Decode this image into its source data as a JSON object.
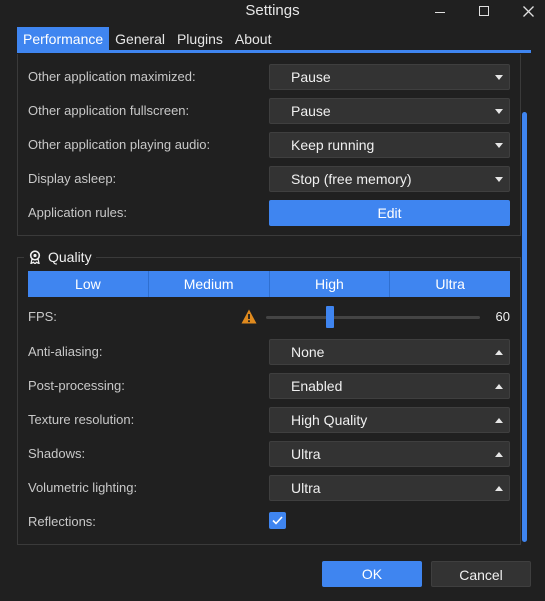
{
  "window": {
    "title": "Settings"
  },
  "tabs": [
    {
      "label": "Performance",
      "active": true
    },
    {
      "label": "General",
      "active": false
    },
    {
      "label": "Plugins",
      "active": false
    },
    {
      "label": "About",
      "active": false
    }
  ],
  "performance": {
    "rows": [
      {
        "label": "Other application maximized:",
        "value": "Pause"
      },
      {
        "label": "Other application fullscreen:",
        "value": "Pause"
      },
      {
        "label": "Other application playing audio:",
        "value": "Keep running"
      },
      {
        "label": "Display asleep:",
        "value": "Stop (free memory)"
      }
    ],
    "app_rules": {
      "label": "Application rules:",
      "button": "Edit"
    }
  },
  "quality": {
    "title": "Quality",
    "presets": [
      "Low",
      "Medium",
      "High",
      "Ultra"
    ],
    "fps": {
      "label": "FPS:",
      "value": "60",
      "slider_fraction": 0.3
    },
    "settings": [
      {
        "label": "Anti-aliasing:",
        "value": "None"
      },
      {
        "label": "Post-processing:",
        "value": "Enabled"
      },
      {
        "label": "Texture resolution:",
        "value": "High Quality"
      },
      {
        "label": "Shadows:",
        "value": "Ultra"
      },
      {
        "label": "Volumetric lighting:",
        "value": "Ultra"
      }
    ],
    "reflections": {
      "label": "Reflections:",
      "checked": true
    }
  },
  "footer": {
    "ok": "OK",
    "cancel": "Cancel"
  },
  "colors": {
    "accent": "#3f85f0",
    "background": "#202020",
    "control": "#333333",
    "warning": "#e08a1e"
  },
  "icons": {
    "minimize": "minimize-icon",
    "maximize": "maximize-icon",
    "close": "close-icon",
    "quality": "award-icon",
    "warning": "warning-icon",
    "check": "check-icon"
  }
}
